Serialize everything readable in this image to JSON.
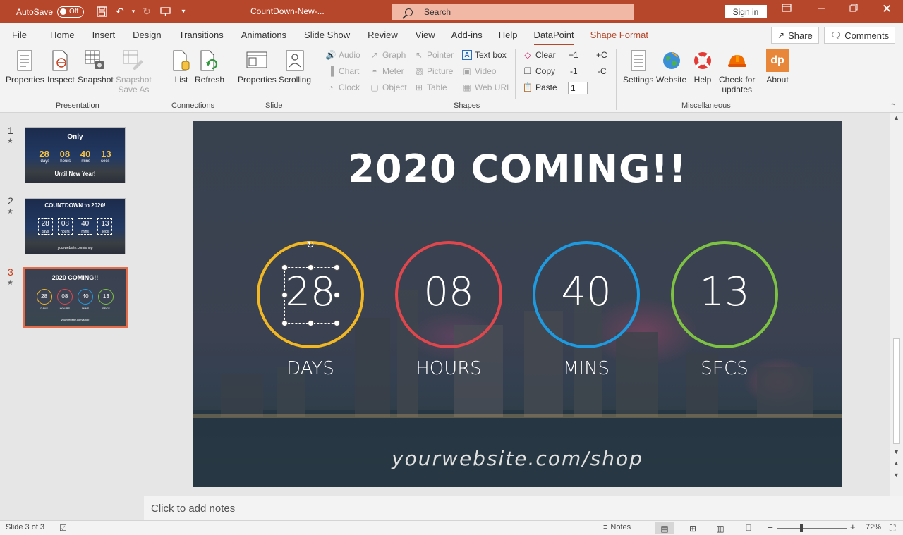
{
  "titlebar": {
    "autosave_label": "AutoSave",
    "autosave_state": "Off",
    "filename": "CountDown-New-...",
    "search_placeholder": "Search",
    "signin_label": "Sign in",
    "accent": "#b7472a"
  },
  "tabs": {
    "items": [
      "File",
      "Home",
      "Insert",
      "Design",
      "Transitions",
      "Animations",
      "Slide Show",
      "Review",
      "View",
      "Add-ins",
      "Help",
      "DataPoint",
      "Shape Format"
    ],
    "active": "DataPoint",
    "share_label": "Share",
    "comments_label": "Comments"
  },
  "ribbon": {
    "presentation": {
      "label": "Presentation",
      "properties": "Properties",
      "inspect": "Inspect",
      "snapshot": "Snapshot",
      "snapshot_save_as_1": "Snapshot",
      "snapshot_save_as_2": "Save As"
    },
    "connections": {
      "label": "Connections",
      "list": "List",
      "refresh": "Refresh"
    },
    "slide": {
      "label": "Slide",
      "properties": "Properties",
      "scrolling": "Scrolling"
    },
    "shapes": {
      "label": "Shapes",
      "audio": "Audio",
      "chart": "Chart",
      "clock": "Clock",
      "graph": "Graph",
      "meter": "Meter",
      "object": "Object",
      "pointer": "Pointer",
      "picture": "Picture",
      "table": "Table",
      "textbox": "Text box",
      "video": "Video",
      "weburl": "Web URL",
      "clear": "Clear",
      "copy": "Copy",
      "paste": "Paste",
      "plus1": "+1",
      "minus1": "-1",
      "plusC": "+C",
      "minusC": "-C",
      "value": "1"
    },
    "misc": {
      "label": "Miscellaneous",
      "settings": "Settings",
      "website": "Website",
      "help": "Help",
      "check_1": "Check for",
      "check_2": "updates",
      "about": "About",
      "about_logo": "dp"
    }
  },
  "thumbnails": [
    {
      "num": "1",
      "top_text": "Only",
      "values": [
        "28",
        "08",
        "40",
        "13"
      ],
      "units": [
        "days",
        "hours",
        "mins",
        "secs"
      ],
      "bottom_text": "Until New Year!"
    },
    {
      "num": "2",
      "top_text": "COUNTDOWN to 2020!",
      "values": [
        "28",
        "08",
        "40",
        "13"
      ],
      "units": [
        "days",
        "hours",
        "mins",
        "secs"
      ],
      "bottom_text": "yourwebsite.com/shop"
    },
    {
      "num": "3",
      "top_text": "2020 COMING!!",
      "values": [
        "28",
        "08",
        "40",
        "13"
      ],
      "units": [
        "DAYS",
        "HOURS",
        "MINS",
        "SECS"
      ],
      "bottom_text": "yourwebsite.com/shop"
    }
  ],
  "slide": {
    "title": "2020 COMING!!",
    "counters": [
      {
        "value": "28",
        "label": "DAYS",
        "color": "#f2b824"
      },
      {
        "value": "08",
        "label": "HOURS",
        "color": "#e0474c"
      },
      {
        "value": "40",
        "label": "MINS",
        "color": "#1e9be0"
      },
      {
        "value": "13",
        "label": "SECS",
        "color": "#7dc242"
      }
    ],
    "url": "yourwebsite.com/shop"
  },
  "notes_placeholder": "Click to add notes",
  "statusbar": {
    "slide_info": "Slide 3 of 3",
    "notes_label": "Notes",
    "zoom": "72%"
  }
}
